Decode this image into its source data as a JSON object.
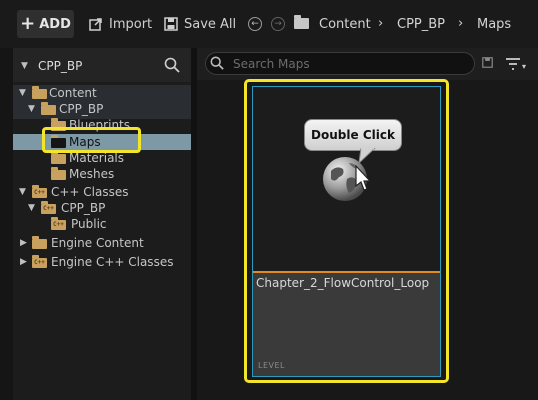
{
  "toolbar": {
    "add_label": "ADD",
    "import_label": "Import",
    "save_all_label": "Save All"
  },
  "breadcrumb": [
    "Content",
    "CPP_BP",
    "Maps"
  ],
  "sidebar": {
    "project_name": "CPP_BP",
    "tree": [
      {
        "label": "Content"
      },
      {
        "label": "CPP_BP"
      },
      {
        "label": "Blueprints"
      },
      {
        "label": "Maps"
      },
      {
        "label": "Materials"
      },
      {
        "label": "Meshes"
      },
      {
        "label": "C++ Classes"
      },
      {
        "label": "CPP_BP"
      },
      {
        "label": "Public"
      },
      {
        "label": "Engine Content"
      },
      {
        "label": "Engine C++ Classes"
      }
    ]
  },
  "search": {
    "placeholder": "Search Maps"
  },
  "asset": {
    "name": "Chapter_2_FlowControl_Loop",
    "type": "LEVEL"
  },
  "annotation": {
    "tooltip": "Double Click"
  },
  "colors": {
    "highlight": "#f2e52a",
    "selection_row": "#7d99a5",
    "card_border": "#2f98bf",
    "asset_type_bar": "#e08b1c",
    "folder": "#c9a15f"
  }
}
